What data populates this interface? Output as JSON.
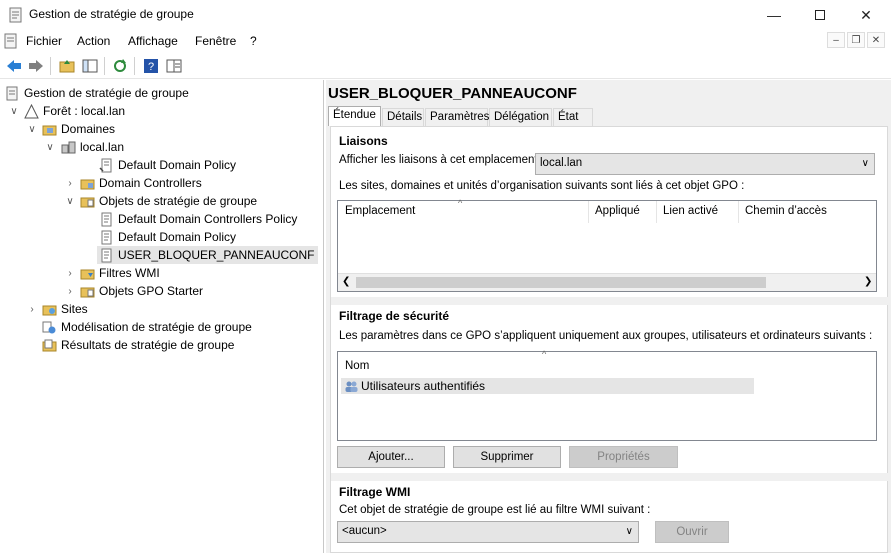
{
  "window": {
    "title": "Gestion de stratégie de groupe"
  },
  "menu": [
    "Fichier",
    "Action",
    "Affichage",
    "Fenêtre",
    "?"
  ],
  "tree": {
    "root": "Gestion de stratégie de groupe",
    "forest": "Forêt : local.lan",
    "domains": "Domaines",
    "domain": "local.lan",
    "ddp": "Default Domain Policy",
    "dc": "Domain Controllers",
    "gpo_container": "Objets de stratégie de groupe",
    "gpo1": "Default Domain Controllers Policy",
    "gpo2": "Default Domain Policy",
    "gpo3": "USER_BLOQUER_PANNEAUCONF",
    "wmi": "Filtres WMI",
    "starter": "Objets GPO Starter",
    "sites": "Sites",
    "modeling": "Modélisation de stratégie de groupe",
    "results": "Résultats de stratégie de groupe"
  },
  "details": {
    "title": "USER_BLOQUER_PANNEAUCONF",
    "tabs": [
      "Étendue",
      "Détails",
      "Paramètres",
      "Délégation",
      "État"
    ],
    "links": {
      "heading": "Liaisons",
      "location_label": "Afficher les liaisons à cet emplacement :",
      "location_value": "local.lan",
      "desc": "Les sites, domaines et unités d’organisation suivants sont liés à cet objet GPO :",
      "columns": [
        "Emplacement",
        "Appliqué",
        "Lien activé",
        "Chemin d’accès"
      ]
    },
    "security": {
      "heading": "Filtrage de sécurité",
      "desc": "Les paramètres dans ce GPO s’appliquent uniquement aux groupes, utilisateurs et ordinateurs suivants :",
      "column": "Nom",
      "rows": [
        "Utilisateurs authentifiés"
      ],
      "add": "Ajouter...",
      "remove": "Supprimer",
      "props": "Propriétés"
    },
    "wmi": {
      "heading": "Filtrage WMI",
      "desc": "Cet objet de stratégie de groupe est lié au filtre WMI suivant :",
      "value": "<aucun>",
      "open": "Ouvrir"
    }
  }
}
